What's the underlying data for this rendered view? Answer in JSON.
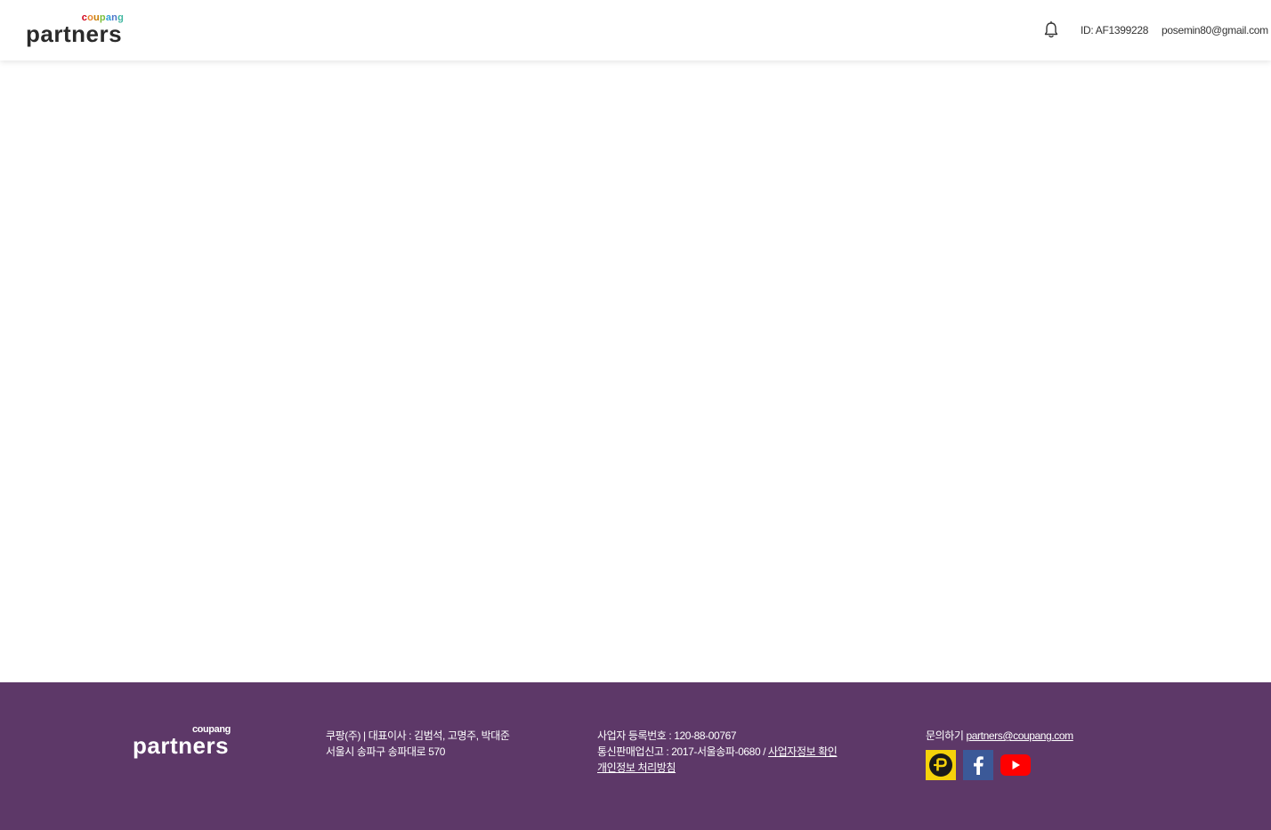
{
  "header": {
    "logo_top": "coupang",
    "logo_main": "partners",
    "user_id": "ID: AF1399228",
    "user_email": "posemin80@gmail.com"
  },
  "footer": {
    "logo_top": "coupang",
    "logo_main": "partners",
    "company_line1": "쿠팡(주) | 대표이사 : 김범석, 고명주, 박대준",
    "company_line2": "서울시 송파구 송파대로 570",
    "biz_reg": "사업자 등록번호 : 120-88-00767",
    "ecommerce_reg": "통신판매업신고 : 2017-서울송파-0680 / ",
    "biz_info_link": "사업자정보 확인",
    "privacy_link": "개인정보 처리방침",
    "contact_label": "문의하기 ",
    "contact_email": "partners@coupang.com",
    "social": [
      "coupang-point-icon",
      "facebook-icon",
      "youtube-icon"
    ]
  },
  "colors": {
    "footer_bg": "#5d3868",
    "logo_c": "#d0021b",
    "logo_o": "#e8842a",
    "logo_u": "#f5b400",
    "logo_p": "#7cbf3a",
    "logo_a": "#2f9fd8",
    "logo_n": "#4a74c9",
    "logo_g": "#41b7a0"
  }
}
